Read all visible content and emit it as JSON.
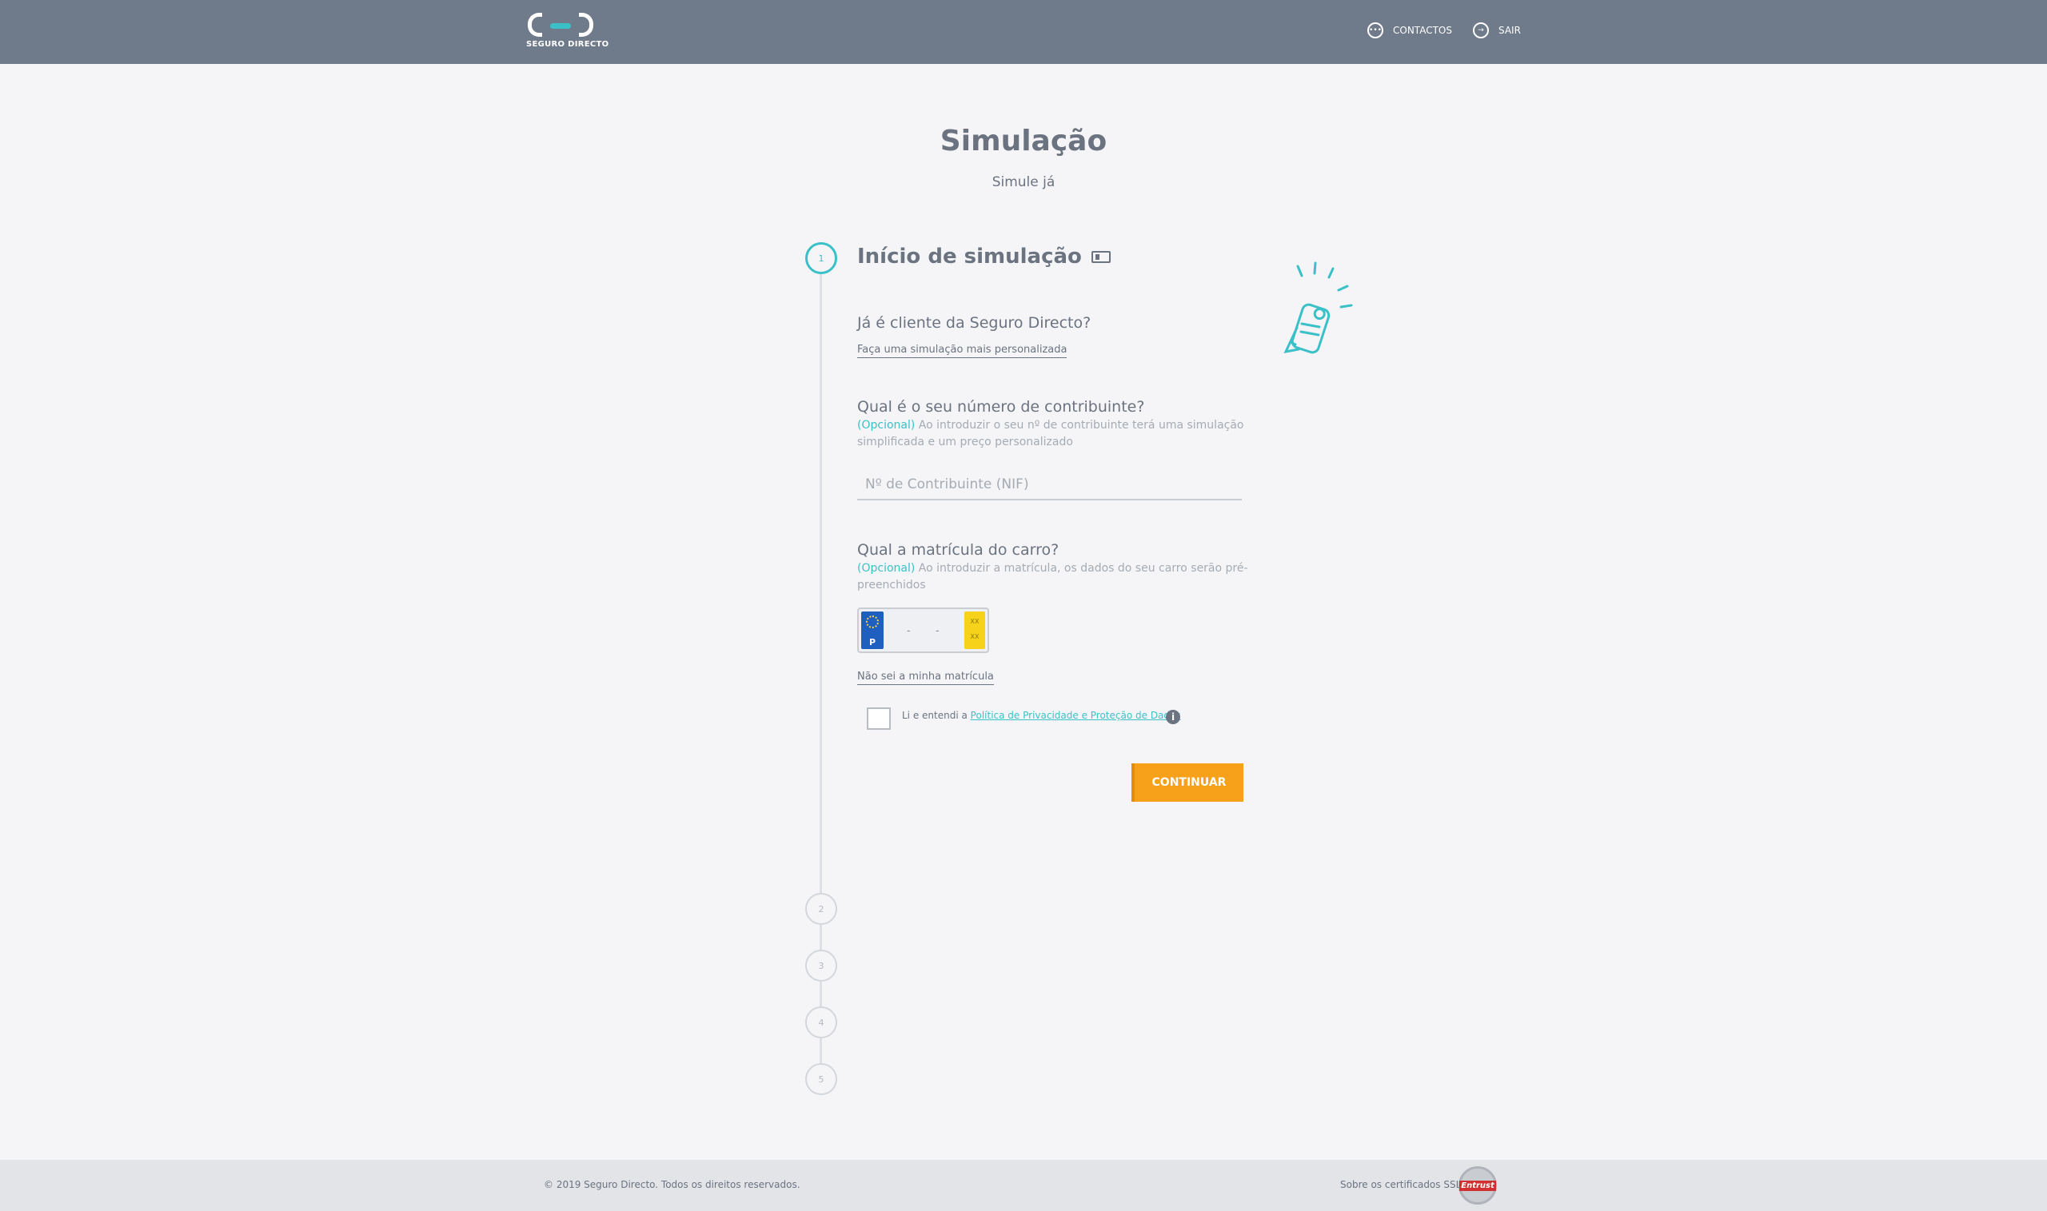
{
  "header": {
    "logo_text": "SEGURO DIRECTO",
    "nav": {
      "contactos_label": "CONTACTOS",
      "sair_label": "SAIR"
    }
  },
  "page": {
    "title": "Simulação",
    "subtitle": "Simule já"
  },
  "steps": [
    "1",
    "2",
    "3",
    "4",
    "5"
  ],
  "section": {
    "title": "Início de simulação"
  },
  "client_question": {
    "label": "Já é cliente da Seguro Directo?",
    "link": "Faça uma simulação mais personalizada"
  },
  "nif_question": {
    "label": "Qual é o seu número de contribuinte?",
    "optional": "(Opcional)",
    "hint": "Ao introduzir o seu nº de contribuinte terá uma simulação simplificada e um preço personalizado",
    "placeholder": "Nº de Contribuinte (NIF)",
    "value": ""
  },
  "plate_question": {
    "label": "Qual a matrícula do carro?",
    "optional": "(Opcional)",
    "hint": "Ao introduzir a matrícula, os dados do seu carro serão pré-preenchidos",
    "country": "P",
    "dash1": "-",
    "dash2": "-",
    "year_top": "XX",
    "year_bottom": "XX",
    "link": "Não sei a minha matrícula"
  },
  "consent": {
    "text": "Li e entendi a",
    "link": "Política de Privacidade e Proteção de Dados",
    "checked": false
  },
  "continue_button": "CONTINUAR",
  "footer": {
    "copyright": "© 2019 Seguro Directo. Todos os direitos reservados.",
    "ssl_text": "Sobre os certificados SSL:",
    "entrust_logo": "Entrust"
  },
  "colors": {
    "header_bg": "#6f7a8a",
    "accent": "#3cc0c8",
    "button": "#f7a11a"
  }
}
